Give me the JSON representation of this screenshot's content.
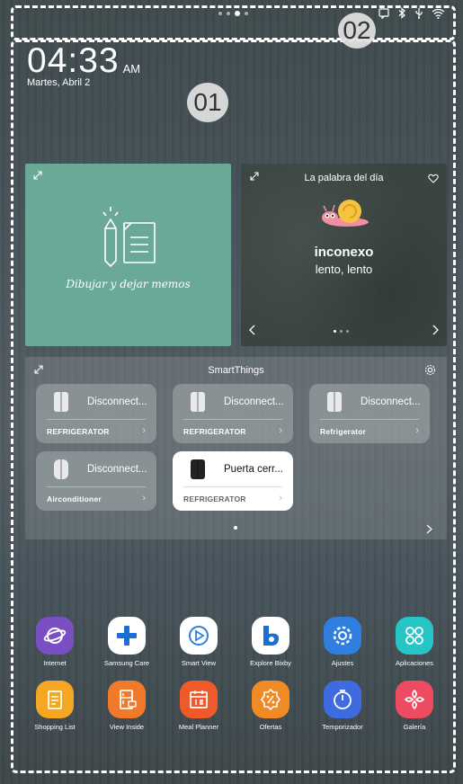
{
  "annotations": {
    "badge_1": "01",
    "badge_2": "02"
  },
  "clock": {
    "time": "04:33",
    "ampm": "AM",
    "date": "Martes, Abril 2"
  },
  "memo_widget": {
    "label": "Dibujar y dejar memos"
  },
  "word_widget": {
    "title": "La palabra del día",
    "word": "inconexo",
    "meaning": "lento, lento"
  },
  "smartthings": {
    "title": "SmartThings",
    "devices": [
      {
        "name": "Disconnect...",
        "type": "REFRIGERATOR",
        "style": "gray"
      },
      {
        "name": "Disconnect...",
        "type": "REFRIGERATOR",
        "style": "gray"
      },
      {
        "name": "Disconnect...",
        "type": "Refrigerator",
        "style": "gray"
      },
      {
        "name": "Disconnect...",
        "type": "Airconditioner",
        "style": "gray"
      },
      {
        "name": "Puerta cerr...",
        "type": "REFRIGERATOR",
        "style": "white"
      }
    ]
  },
  "apps": [
    {
      "label": "Internet",
      "icon": "internet-icon",
      "color": "#7b4fc4"
    },
    {
      "label": "Samsung Care",
      "icon": "samsung-care-icon",
      "color": "#ffffff"
    },
    {
      "label": "Smart View",
      "icon": "smart-view-icon",
      "color": "#ffffff"
    },
    {
      "label": "Explore Bixby",
      "icon": "bixby-icon",
      "color": "#ffffff"
    },
    {
      "label": "Ajustes",
      "icon": "settings-icon",
      "color": "#2f7fe0"
    },
    {
      "label": "Aplicaciones",
      "icon": "apps-icon",
      "color": "#26c4c4"
    },
    {
      "label": "Shopping List",
      "icon": "shopping-list-icon",
      "color": "#f5a623"
    },
    {
      "label": "View Inside",
      "icon": "view-inside-icon",
      "color": "#f07a2a"
    },
    {
      "label": "Meal Planner",
      "icon": "meal-planner-icon",
      "color": "#f05a2a"
    },
    {
      "label": "Ofertas",
      "icon": "offers-icon",
      "color": "#f08a24"
    },
    {
      "label": "Temporizador",
      "icon": "timer-icon",
      "color": "#3f6be0"
    },
    {
      "label": "Galería",
      "icon": "gallery-icon",
      "color": "#ee4a62"
    }
  ]
}
